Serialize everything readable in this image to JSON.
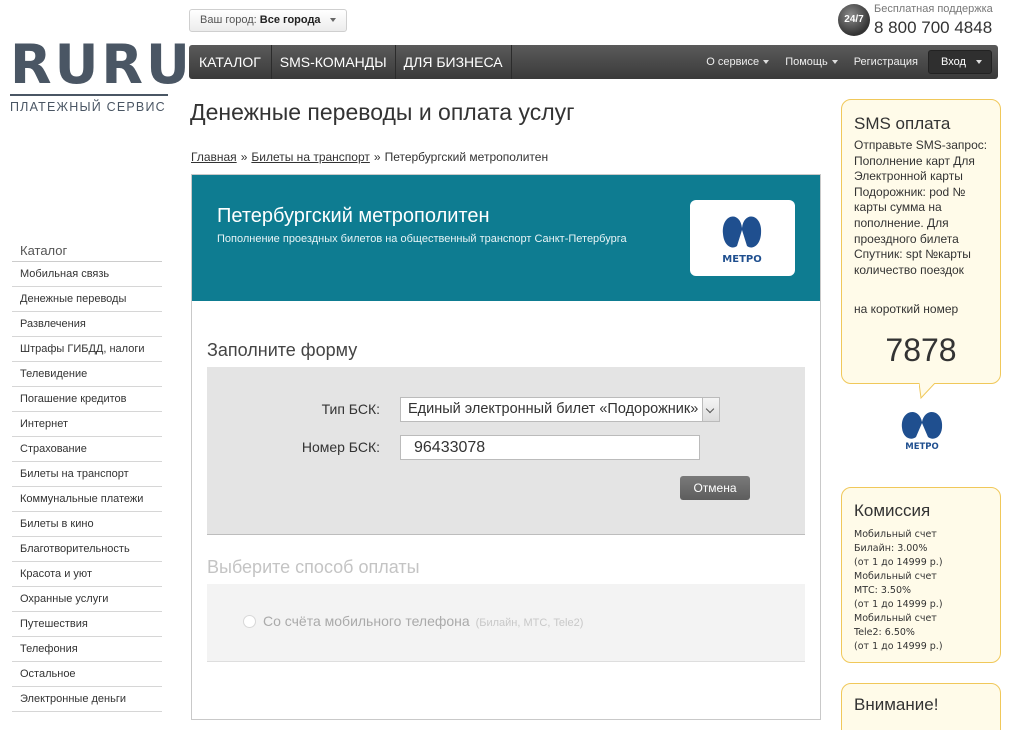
{
  "header": {
    "city_label": "Ваш город:",
    "city_value": "Все города",
    "support_badge": "24/7",
    "support_label": "Бесплатная поддержка",
    "support_phone": "8 800 700 4848"
  },
  "logo": {
    "main": "RURU",
    "sub": "ПЛАТЕЖНЫЙ СЕРВИС"
  },
  "nav": {
    "left": [
      "КАТАЛОГ",
      "SMS-КОМАНДЫ",
      "ДЛЯ БИЗНЕСА"
    ],
    "right": [
      "О сервисе",
      "Помощь",
      "Регистрация"
    ],
    "login": "Вход"
  },
  "sidebar": {
    "title": "Каталог",
    "items": [
      "Мобильная связь",
      "Денежные переводы",
      "Развлечения",
      "Штрафы ГИБДД, налоги",
      "Телевидение",
      "Погашение кредитов",
      "Интернет",
      "Страхование",
      "Билеты на транспорт",
      "Коммунальные платежи",
      "Билеты в кино",
      "Благотворительность",
      "Красота и уют",
      "Охранные услуги",
      "Путешествия",
      "Телефония",
      "Остальное",
      "Электронные деньги"
    ]
  },
  "main": {
    "title": "Денежные переводы и оплата услуг",
    "breadcrumb": [
      "Главная",
      "Билеты на транспорт",
      "Петербургский метрополитен"
    ],
    "breadcrumb_sep": "»",
    "banner_title": "Петербургский метрополитен",
    "banner_sub": "Пополнение проездных билетов на общественный транспорт Санкт-Петербурга",
    "metro_label": "МЕТРО",
    "form_heading": "Заполните форму",
    "type_label": "Тип БСК:",
    "type_value": "Единый электронный билет «Подорожник»",
    "number_label": "Номер БСК:",
    "number_value": "96433078",
    "cancel": "Отмена",
    "pay_heading": "Выберите способ оплаты",
    "pay_option": "Со счёта мобильного телефона",
    "pay_operators": "(Билайн, МТС, Tele2)"
  },
  "sms": {
    "title": "SMS оплата",
    "lines": [
      "Отправьте SMS-запрос:",
      "Пополнение карт Для Электронной карты Подорожник: pod № карты сумма на пополнение. Для проездного билета Спутник: spt №карты количество поездок"
    ],
    "short_label": "на короткий номер",
    "number": "7878"
  },
  "commission": {
    "title": "Комиссия",
    "lines": [
      "Мобильный счет",
      "Билайн: 3.00%",
      "(от 1 до 14999 р.)",
      "Мобильный счет",
      "МТС: 3.50%",
      "(от 1 до 14999 р.)",
      "Мобильный счет",
      "Tele2: 6.50%",
      "(от 1 до 14999 р.)"
    ]
  },
  "warning": {
    "title": "Внимание!"
  },
  "colors": {
    "banner": "#0e7c91",
    "navbar": "#444444",
    "metro_logo": "#1f4f8f",
    "box_border": "#f0c85a"
  }
}
